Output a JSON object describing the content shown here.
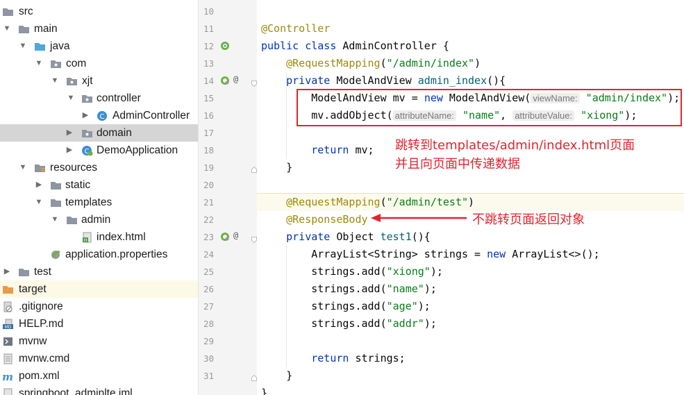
{
  "project_tree": {
    "items": [
      {
        "label": "src",
        "type": "folder"
      },
      {
        "label": "main",
        "type": "folder"
      },
      {
        "label": "java",
        "type": "folder-src"
      },
      {
        "label": "com",
        "type": "package"
      },
      {
        "label": "xjt",
        "type": "package"
      },
      {
        "label": "controller",
        "type": "package"
      },
      {
        "label": "AdminController",
        "type": "class"
      },
      {
        "label": "domain",
        "type": "package"
      },
      {
        "label": "DemoApplication",
        "type": "spring-class"
      },
      {
        "label": "resources",
        "type": "folder-res"
      },
      {
        "label": "static",
        "type": "folder"
      },
      {
        "label": "templates",
        "type": "folder"
      },
      {
        "label": "admin",
        "type": "folder"
      },
      {
        "label": "index.html",
        "type": "html"
      },
      {
        "label": "application.properties",
        "type": "properties"
      },
      {
        "label": "test",
        "type": "folder"
      },
      {
        "label": "target",
        "type": "folder-excluded"
      },
      {
        "label": ".gitignore",
        "type": "file-ignore"
      },
      {
        "label": "HELP.md",
        "type": "markdown"
      },
      {
        "label": "mvnw",
        "type": "script"
      },
      {
        "label": "mvnw.cmd",
        "type": "file"
      },
      {
        "label": "pom.xml",
        "type": "maven"
      },
      {
        "label": "springboot_adminlte.iml",
        "type": "iml"
      }
    ]
  },
  "editor": {
    "line_numbers": [
      "10",
      "11",
      "12",
      "13",
      "14",
      "15",
      "16",
      "17",
      "18",
      "19",
      "20",
      "21",
      "22",
      "23",
      "24",
      "25",
      "26",
      "27",
      "28",
      "29",
      "30",
      "31"
    ],
    "code": {
      "l11_ann": "@Controller",
      "l12_kw": "public class",
      "l12_rest": " AdminController {",
      "l13_ann": "@RequestMapping",
      "l13_open": "(",
      "l13_str": "\"/admin/index\"",
      "l13_close": ")",
      "l14_kw": "private",
      "l14_type": " ModelAndView ",
      "l14_fn": "admin_index",
      "l14_rest": "(){",
      "l15_a": "ModelAndView mv = ",
      "l15_kw": "new",
      "l15_b": " ModelAndView(",
      "l15_hint": "viewName:",
      "l15_str": "\"admin/index\"",
      "l15_end": ");",
      "l16_a": "mv.addObject(",
      "l16_hint1": "attributeName:",
      "l16_str1": "\"name\"",
      "l16_comma": ", ",
      "l16_hint2": "attributeValue:",
      "l16_str2": "\"xiong\"",
      "l16_end": ");",
      "l18_kw": "return",
      "l18_rest": " mv;",
      "l19": "}",
      "l21_ann": "@RequestMapping",
      "l21_open": "(",
      "l21_str": "\"/admin/test\"",
      "l21_close": ")",
      "l22_ann": "@ResponseBody",
      "l23_kw": "private",
      "l23_type": " Object ",
      "l23_fn": "test1",
      "l23_rest": "(){",
      "l24_a": "ArrayList<String> strings = ",
      "l24_kw": "new",
      "l24_b": " ArrayList<>();",
      "l25_a": "strings.add(",
      "l25_str": "\"xiong\"",
      "l25_end": ");",
      "l26_a": "strings.add(",
      "l26_str": "\"name\"",
      "l26_end": ");",
      "l27_a": "strings.add(",
      "l27_str": "\"age\"",
      "l27_end": ");",
      "l28_a": "strings.add(",
      "l28_str": "\"addr\"",
      "l28_end": ");",
      "l30_kw": "return",
      "l30_rest": " strings;",
      "l31": "}",
      "l32": "}"
    }
  },
  "annotations": {
    "note1_line1": "跳转到templates/admin/index.html页面",
    "note1_line2": "并且向页面中传递数据",
    "note2": "不跳转页面返回对象",
    "color": "#e3232c"
  },
  "colors": {
    "keyword": "#0033b3",
    "annotation": "#9e880d",
    "string": "#067d17",
    "method": "#00627a",
    "selected_row": "#d5d5d5",
    "excluded_row": "#fcf9e6"
  }
}
